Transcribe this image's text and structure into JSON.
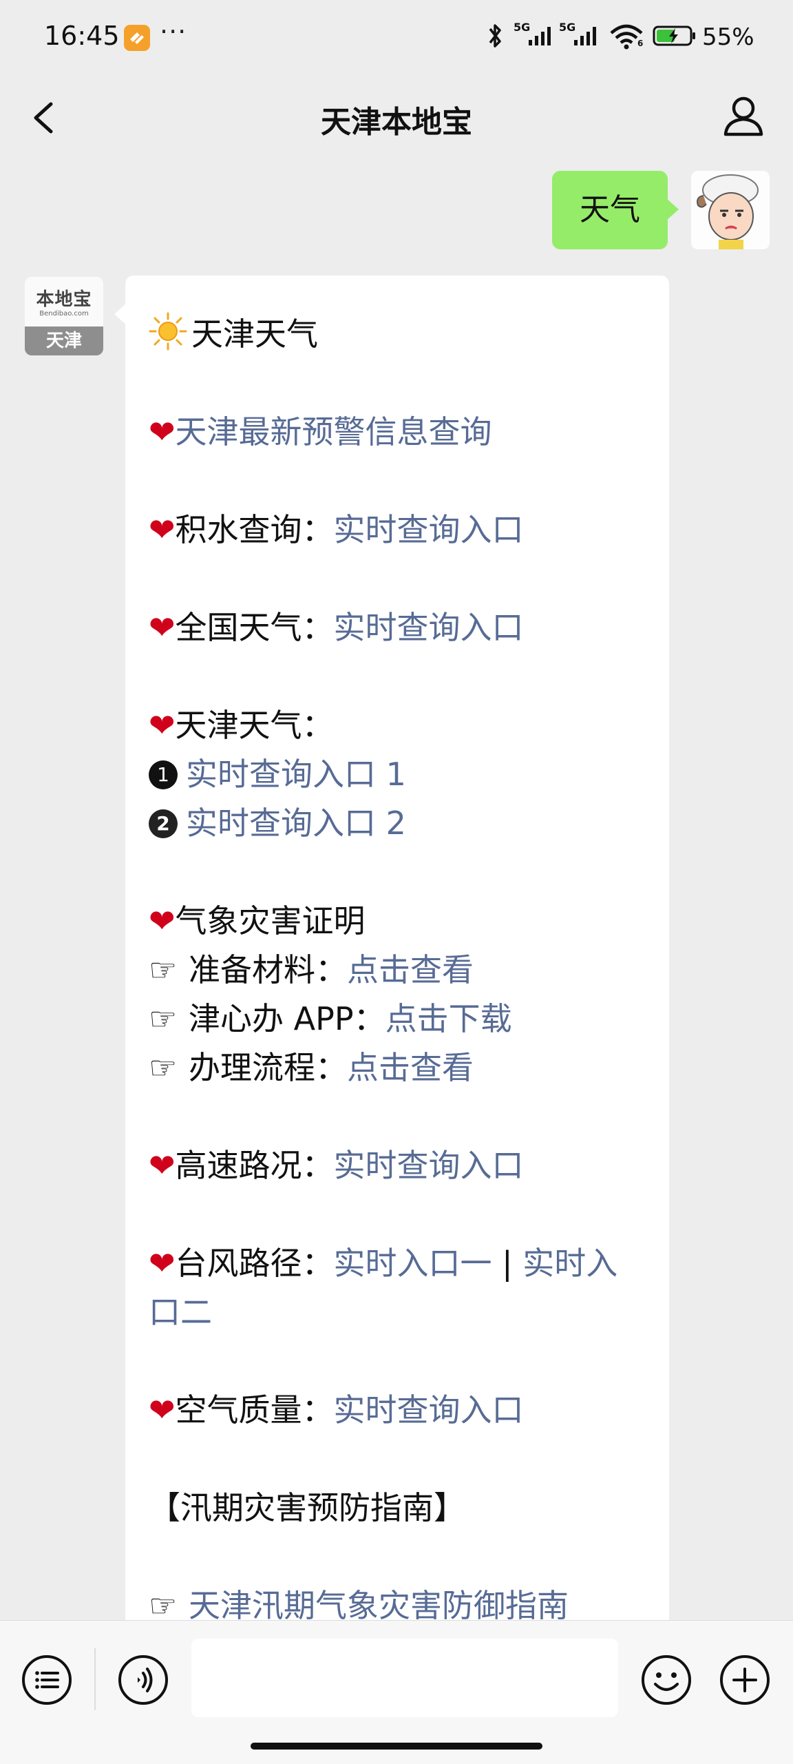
{
  "status_bar": {
    "time": "16:45",
    "app_badge_icon": "orange-app-icon",
    "more": "···",
    "net1": "5G",
    "net2": "5G",
    "wifi_label": "6",
    "battery": "55%"
  },
  "nav": {
    "title": "天津本地宝",
    "back_icon": "chevron-left-icon",
    "profile_icon": "person-icon"
  },
  "messages": {
    "user_text": "天气",
    "bot_avatar": {
      "cn": "本地宝",
      "en": "Bendibao.com",
      "city": "天津"
    },
    "bot": {
      "weather_title": "天津天气",
      "warning_link": "天津最新预警信息查询",
      "water_label": "积水查询：",
      "water_link": "实时查询入口",
      "national_label": "全国天气：",
      "national_link": "实时查询入口",
      "tianjin_label": "天津天气：",
      "entry1_num": "1",
      "entry1_link": "实时查询入口 1",
      "entry2_num": "2",
      "entry2_link": "实时查询入口 2",
      "disaster_title": "气象灾害证明",
      "materials_label": "准备材料：",
      "materials_link": "点击查看",
      "app_label": "津心办 APP：",
      "app_link": "点击下载",
      "process_label": "办理流程：",
      "process_link": "点击查看",
      "highway_label": "高速路况：",
      "highway_link": "实时查询入口",
      "typhoon_label": "台风路径：",
      "typhoon_link1": "实时入口一",
      "typhoon_sep": " | ",
      "typhoon_link2": "实时入口二",
      "air_label": "空气质量：",
      "air_link": "实时查询入口",
      "flood_header": "【汛期灾害预防指南】",
      "flood_link": "天津汛期气象灾害防御指南"
    }
  },
  "input_bar": {
    "menu_icon": "menu-list-icon",
    "voice_icon": "voice-icon",
    "input_value": "",
    "emoji_icon": "emoji-icon",
    "plus_icon": "plus-icon"
  },
  "colors": {
    "background": "#ededed",
    "user_bubble": "#95ec69",
    "link": "#576b95",
    "heart": "#d0021b"
  }
}
